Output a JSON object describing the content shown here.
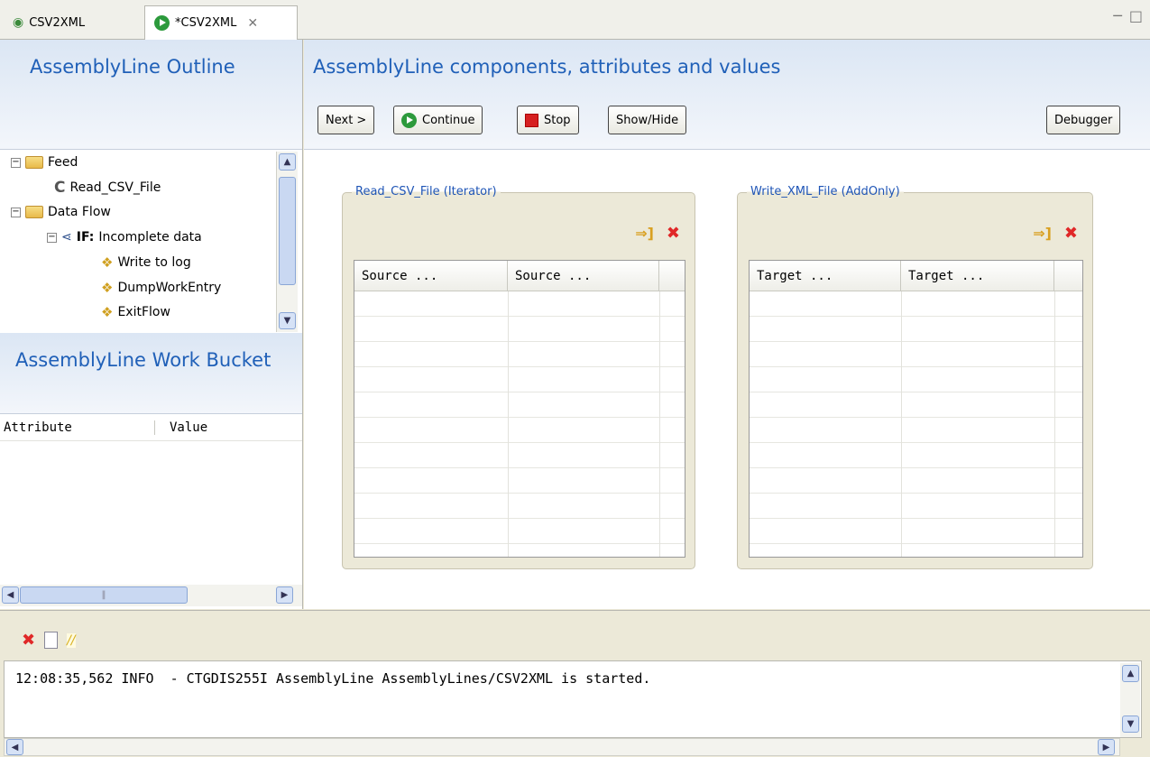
{
  "tabs": [
    {
      "label": "CSV2XML"
    },
    {
      "label": "*CSV2XML"
    }
  ],
  "outline": {
    "title": "AssemblyLine Outline",
    "tree": {
      "feed": "Feed",
      "read_csv": "Read_CSV_File",
      "data_flow": "Data Flow",
      "if_keyword": "IF:",
      "if_label": "Incomplete data",
      "write_log": "Write to log",
      "dump_entry": "DumpWorkEntry",
      "exit_flow": "ExitFlow"
    }
  },
  "bucket": {
    "title": "AssemblyLine Work Bucket",
    "columns": [
      "Attribute",
      "Value"
    ]
  },
  "main": {
    "title": "AssemblyLine components, attributes and values",
    "buttons": {
      "next": "Next >",
      "continue": "Continue",
      "stop": "Stop",
      "show_hide": "Show/Hide",
      "debugger": "Debugger"
    }
  },
  "components": [
    {
      "title": "Read_CSV_File (Iterator)",
      "columns": [
        "Source ...",
        "Source ..."
      ]
    },
    {
      "title": "Write_XML_File (AddOnly)",
      "columns": [
        "Target ...",
        "Target ..."
      ]
    }
  ],
  "console": {
    "message": "12:08:35,562 INFO  - CTGDIS255I AssemblyLine AssemblyLines/CSV2XML is started."
  }
}
